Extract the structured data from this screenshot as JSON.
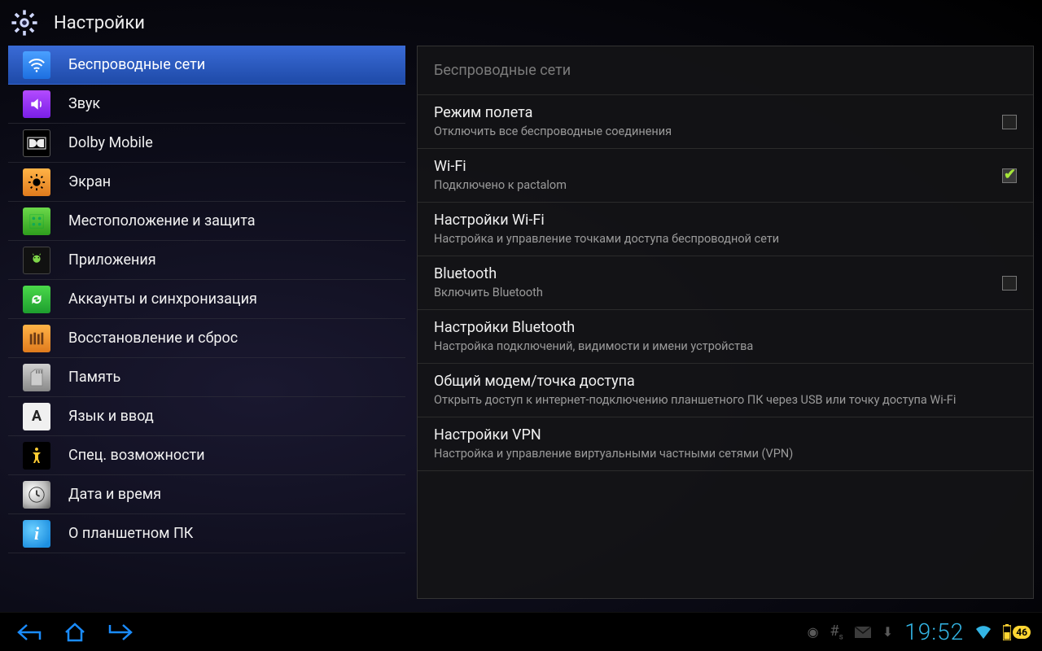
{
  "header": {
    "title": "Настройки"
  },
  "sidebar": {
    "items": [
      {
        "label": "Беспроводные сети"
      },
      {
        "label": "Звук"
      },
      {
        "label": "Dolby Mobile"
      },
      {
        "label": "Экран"
      },
      {
        "label": "Местоположение и защита"
      },
      {
        "label": "Приложения"
      },
      {
        "label": "Аккаунты и синхронизация"
      },
      {
        "label": "Восстановление и сброс"
      },
      {
        "label": "Память"
      },
      {
        "label": "Язык и ввод"
      },
      {
        "label": "Спец. возможности"
      },
      {
        "label": "Дата и время"
      },
      {
        "label": "О планшетном ПК"
      }
    ],
    "selected_index": 0
  },
  "panel": {
    "header": "Беспроводные сети",
    "rows": [
      {
        "title": "Режим полета",
        "sub": "Отключить все беспроводные соединения",
        "checkbox": true,
        "checked": false
      },
      {
        "title": "Wi-Fi",
        "sub": "Подключено к pactalom",
        "checkbox": true,
        "checked": true
      },
      {
        "title": "Настройки Wi-Fi",
        "sub": "Настройка и управление точками доступа беспроводной сети",
        "checkbox": false
      },
      {
        "title": "Bluetooth",
        "sub": "Включить Bluetooth",
        "checkbox": true,
        "checked": false
      },
      {
        "title": "Настройки Bluetooth",
        "sub": "Настройка подключений, видимости и имени устройства",
        "checkbox": false
      },
      {
        "title": "Общий модем/точка доступа",
        "sub": "Открыть доступ к интернет-подключению планшетного ПК через USB или точку доступа Wi-Fi",
        "checkbox": false
      },
      {
        "title": "Настройки VPN",
        "sub": "Настройка и управление виртуальными частными сетями (VPN)",
        "checkbox": false
      }
    ]
  },
  "sysbar": {
    "clock": "19:52",
    "battery": "46"
  }
}
